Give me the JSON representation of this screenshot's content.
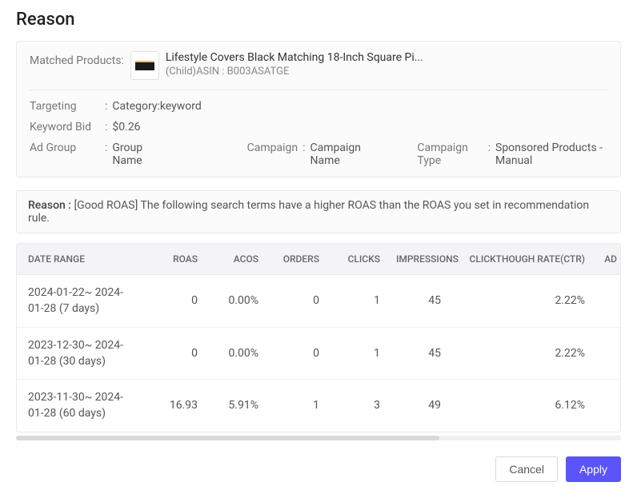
{
  "title": "Reason",
  "matched": {
    "label": "Matched Products:",
    "product_title": "Lifestyle Covers Black Matching 18-Inch Square Pi...",
    "product_sub": "(Child)ASIN : B003ASATGE"
  },
  "info": {
    "targeting_label": "Targeting",
    "targeting_value": "Category:keyword",
    "keyword_bid_label": "Keyword Bid",
    "keyword_bid_value": "$0.26",
    "ad_group_label": "Ad Group",
    "ad_group_value": "Group Name",
    "campaign_label": "Campaign",
    "campaign_value": "Campaign Name",
    "campaign_type_label": "Campaign Type",
    "campaign_type_value": "Sponsored Products - Manual"
  },
  "reason": {
    "label": "Reason :",
    "text": "[Good ROAS] The following search terms have a higher ROAS than the ROAS you set in recommendation rule."
  },
  "table": {
    "headers": [
      "DATE RANGE",
      "ROAS",
      "ACOS",
      "ORDERS",
      "CLICKS",
      "IMPRESSIONS",
      "CLICKTHOUGH RATE(CTR)",
      "AD"
    ],
    "rows": [
      {
        "range": "2024-01-22~ 2024-01-28 (7 days)",
        "roas": "0",
        "acos": "0.00%",
        "orders": "0",
        "clicks": "1",
        "impr": "45",
        "ctr": "2.22%"
      },
      {
        "range": "2023-12-30~ 2024-01-28 (30 days)",
        "roas": "0",
        "acos": "0.00%",
        "orders": "0",
        "clicks": "1",
        "impr": "45",
        "ctr": "2.22%"
      },
      {
        "range": "2023-11-30~ 2024-01-28 (60 days)",
        "roas": "16.93",
        "acos": "5.91%",
        "orders": "1",
        "clicks": "3",
        "impr": "49",
        "ctr": "6.12%"
      }
    ]
  },
  "footer": {
    "cancel": "Cancel",
    "apply": "Apply"
  }
}
